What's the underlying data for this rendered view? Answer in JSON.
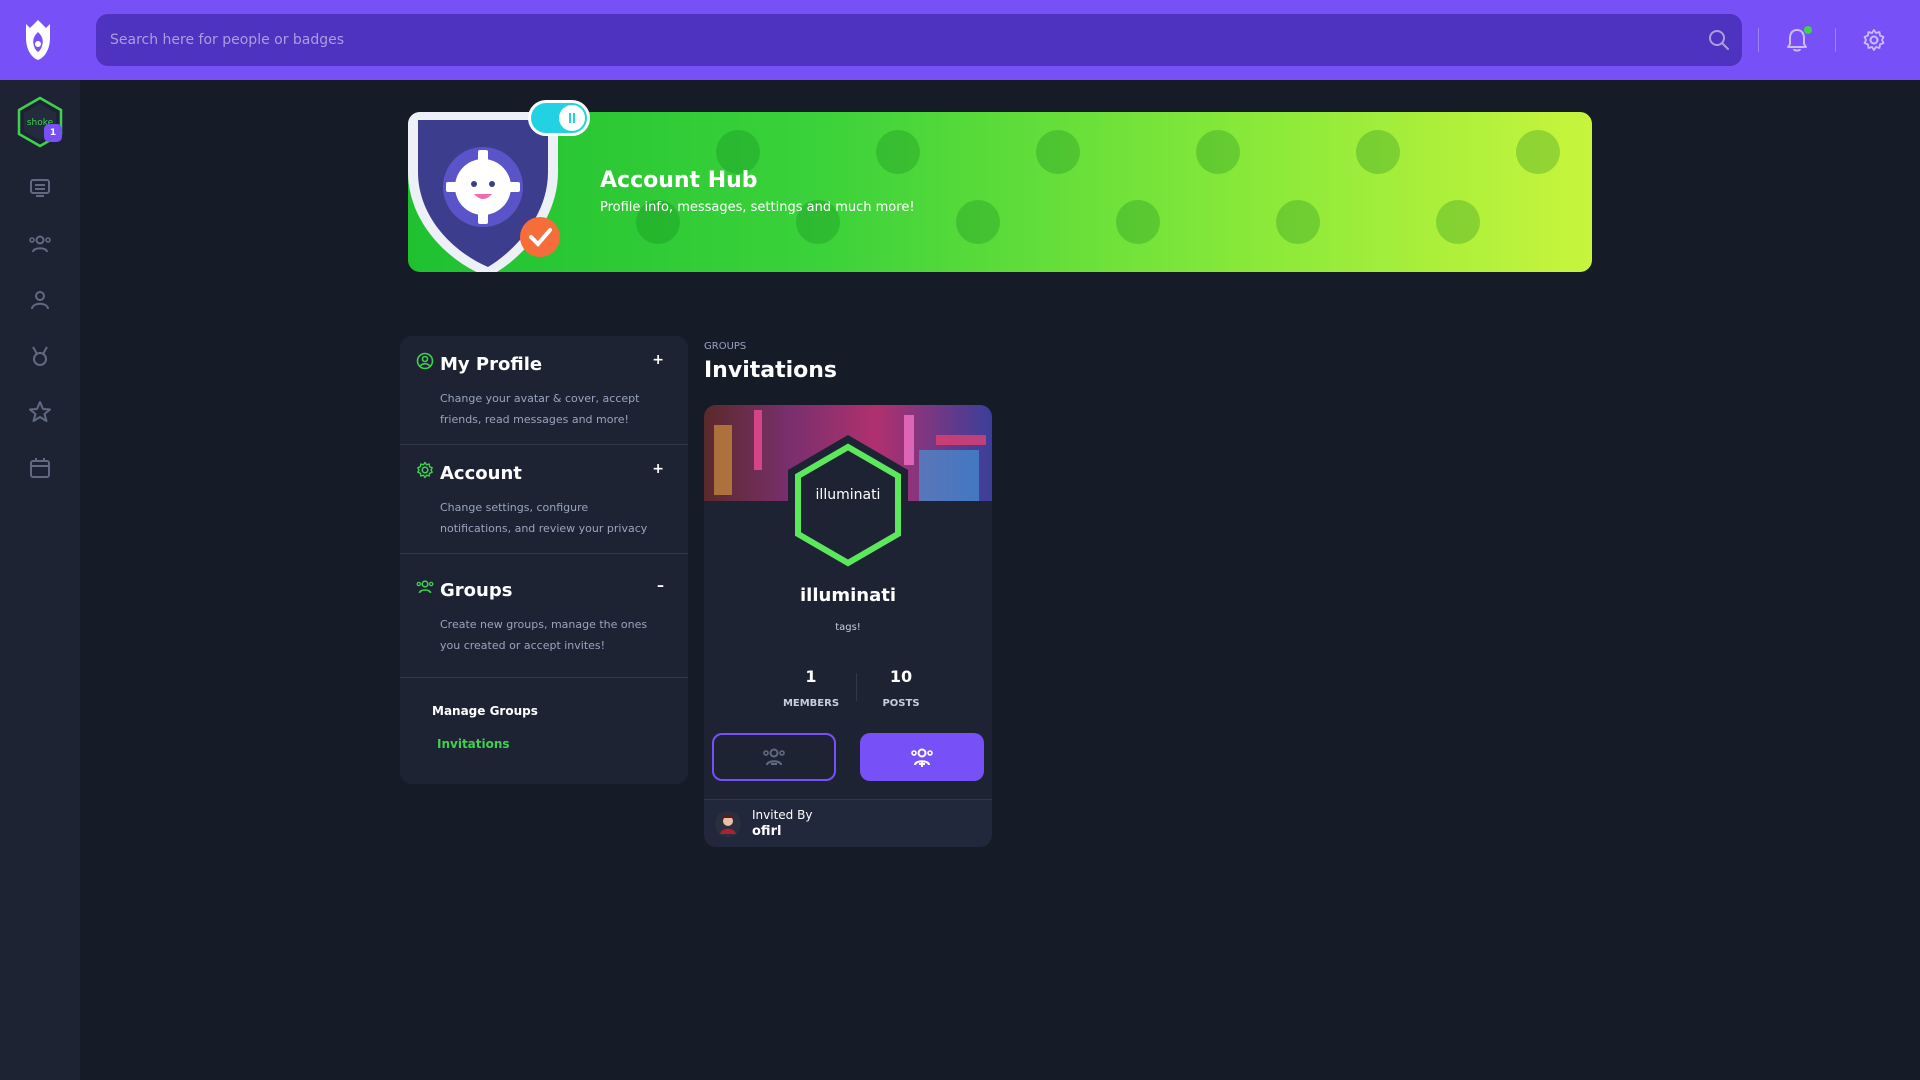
{
  "header": {
    "search_placeholder": "Search here for people or badges"
  },
  "sidebar": {
    "profile_badge": "1",
    "avatar_text": "shoke",
    "items": [
      {
        "icon": "newsfeed-icon"
      },
      {
        "icon": "groups-icon"
      },
      {
        "icon": "members-icon"
      },
      {
        "icon": "badges-icon"
      },
      {
        "icon": "quests-icon"
      },
      {
        "icon": "events-icon"
      }
    ]
  },
  "banner": {
    "title": "Account Hub",
    "subtitle": "Profile info, messages, settings and much more!"
  },
  "menu": {
    "sections": [
      {
        "title": "My Profile",
        "toggle": "+",
        "desc": "Change your avatar & cover, accept friends, read messages and more!"
      },
      {
        "title": "Account",
        "toggle": "+",
        "desc": "Change settings, configure notifications, and review your privacy"
      },
      {
        "title": "Groups",
        "toggle": "–",
        "desc": "Create new groups, manage the ones you created or accept invites!"
      }
    ],
    "sub_links": [
      {
        "label": "Manage Groups",
        "active": false
      },
      {
        "label": "Invitations",
        "active": true
      }
    ]
  },
  "main": {
    "eyebrow": "GROUPS",
    "title": "Invitations"
  },
  "card": {
    "hex_label": "illuminati",
    "name": "illuminati",
    "tags": "tags!",
    "stats": [
      {
        "value": "1",
        "label": "MEMBERS"
      },
      {
        "value": "10",
        "label": "POSTS"
      }
    ],
    "invited_by_label": "Invited By",
    "inviter": "ofirl"
  },
  "colors": {
    "accent": "#7750f8",
    "green": "#40d04f",
    "background": "#161b28",
    "panel": "#1d2333"
  }
}
